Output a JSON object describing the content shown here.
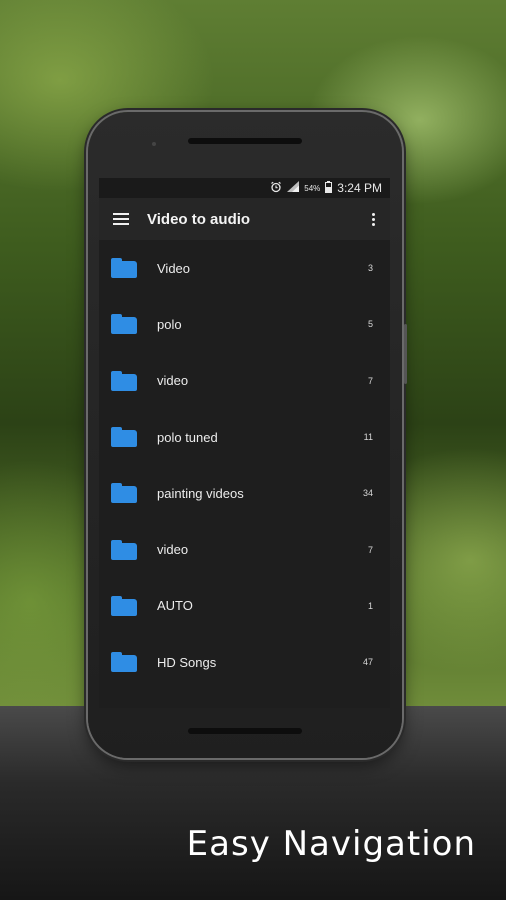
{
  "status_bar": {
    "battery": "54%",
    "time": "3:24 PM",
    "alarm_icon": "alarm-icon",
    "signal_icon": "signal-icon"
  },
  "toolbar": {
    "title": "Video to audio",
    "menu_icon": "hamburger-menu-icon",
    "overflow_icon": "more-vertical-icon"
  },
  "folders": [
    {
      "name": "Video",
      "count": "3"
    },
    {
      "name": "polo",
      "count": "5"
    },
    {
      "name": "video",
      "count": "7"
    },
    {
      "name": "polo tuned",
      "count": "11"
    },
    {
      "name": "painting videos",
      "count": "34"
    },
    {
      "name": "video",
      "count": "7"
    },
    {
      "name": "AUTO",
      "count": "1"
    },
    {
      "name": "HD Songs",
      "count": "47"
    }
  ],
  "caption": "Easy Navigation",
  "colors": {
    "folder": "#2f8de4",
    "toolbar": "#262626",
    "screen": "#1e1e1e"
  }
}
